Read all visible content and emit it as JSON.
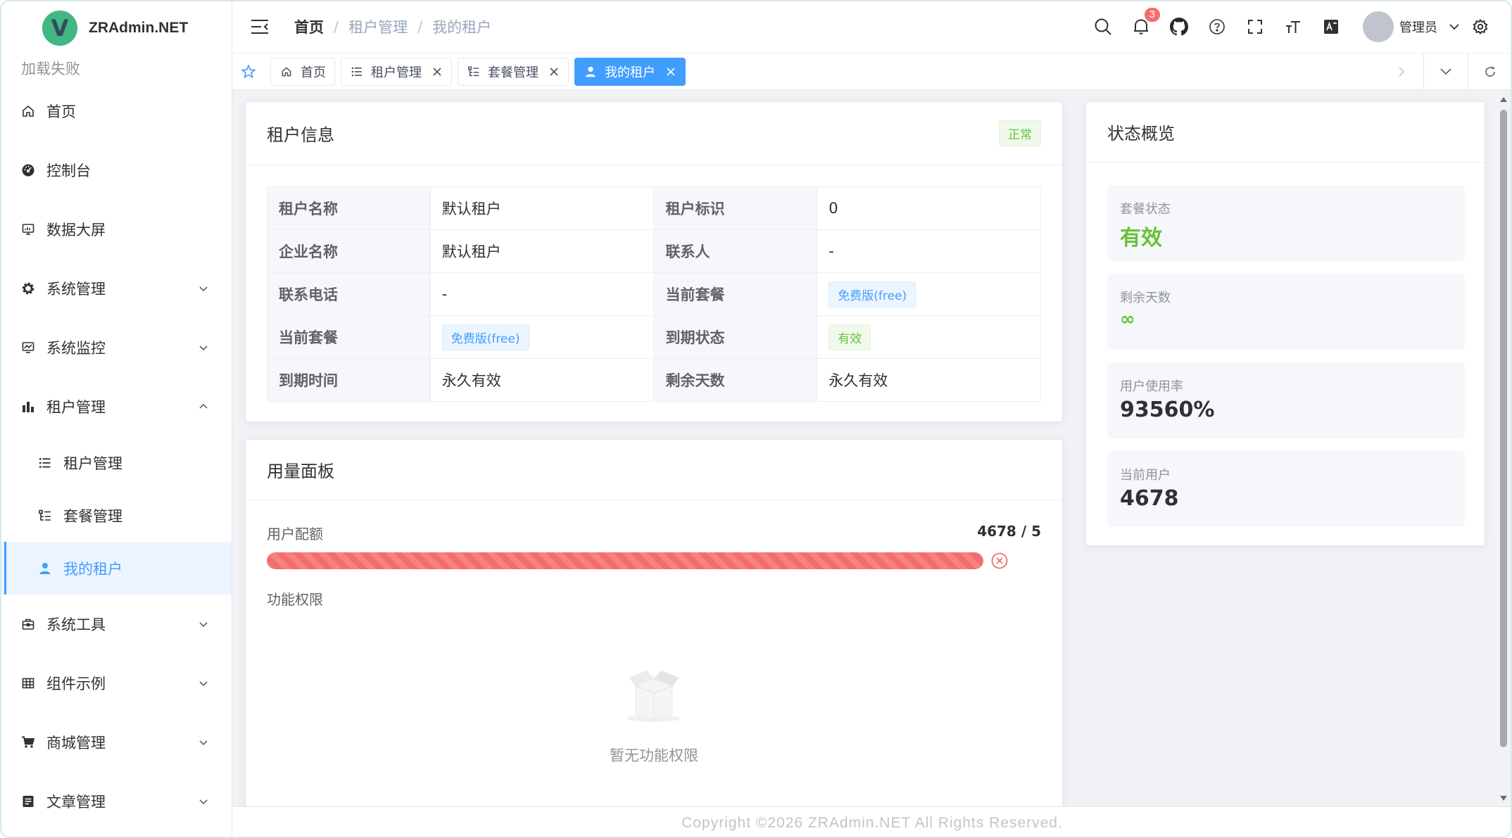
{
  "app": {
    "title": "ZRAdmin.NET",
    "logo_letter": "V",
    "load_fail": "加载失败"
  },
  "sidebar": {
    "items": [
      {
        "label": "首页",
        "icon": "home-icon"
      },
      {
        "label": "控制台",
        "icon": "dashboard-icon"
      },
      {
        "label": "数据大屏",
        "icon": "monitor-screen-icon"
      },
      {
        "label": "系统管理",
        "icon": "gear-icon"
      },
      {
        "label": "系统监控",
        "icon": "chart-monitor-icon"
      },
      {
        "label": "租户管理",
        "icon": "bar-chart-icon"
      },
      {
        "label": "系统工具",
        "icon": "toolbox-icon"
      },
      {
        "label": "组件示例",
        "icon": "table-icon"
      },
      {
        "label": "商城管理",
        "icon": "cart-icon"
      },
      {
        "label": "文章管理",
        "icon": "document-icon"
      }
    ],
    "sub_items": [
      {
        "label": "租户管理",
        "icon": "list-icon"
      },
      {
        "label": "套餐管理",
        "icon": "tree-list-icon"
      },
      {
        "label": "我的租户",
        "icon": "user-icon"
      }
    ]
  },
  "header": {
    "breadcrumb": [
      "首页",
      "租户管理",
      "我的租户"
    ],
    "notification_count": "3",
    "user_name": "管理员"
  },
  "tags": [
    {
      "label": "首页"
    },
    {
      "label": "租户管理"
    },
    {
      "label": "套餐管理"
    },
    {
      "label": "我的租户"
    }
  ],
  "tenant_info": {
    "title": "租户信息",
    "status": "正常",
    "rows": [
      {
        "l1": "租户名称",
        "v1": "默认租户",
        "l2": "租户标识",
        "v2": "0"
      },
      {
        "l1": "企业名称",
        "v1": "默认租户",
        "l2": "联系人",
        "v2": "-"
      },
      {
        "l1": "联系电话",
        "v1": "-",
        "l2": "当前套餐",
        "v2": "免费版(free)"
      },
      {
        "l1": "当前套餐",
        "v1": "免费版(free)",
        "l2": "到期状态",
        "v2": "有效"
      },
      {
        "l1": "到期时间",
        "v1": "永久有效",
        "l2": "剩余天数",
        "v2": "永久有效"
      }
    ]
  },
  "usage": {
    "title": "用量面板",
    "quota_label": "用户配额",
    "quota_value": "4678 / 5",
    "quota_fill_percent": 100,
    "perm_label": "功能权限",
    "empty_text": "暂无功能权限"
  },
  "overview": {
    "title": "状态概览",
    "stats": [
      {
        "label": "套餐状态",
        "value": "有效"
      },
      {
        "label": "剩余天数",
        "value": "∞"
      },
      {
        "label": "用户使用率",
        "value": "93560%"
      },
      {
        "label": "当前用户",
        "value": "4678"
      }
    ]
  },
  "footer": {
    "text": "Copyright ©2026 ZRAdmin.NET All Rights Reserved."
  },
  "colors": {
    "primary": "#409eff",
    "success": "#67c23a",
    "danger": "#f56c6c",
    "brand": "#41b883"
  }
}
